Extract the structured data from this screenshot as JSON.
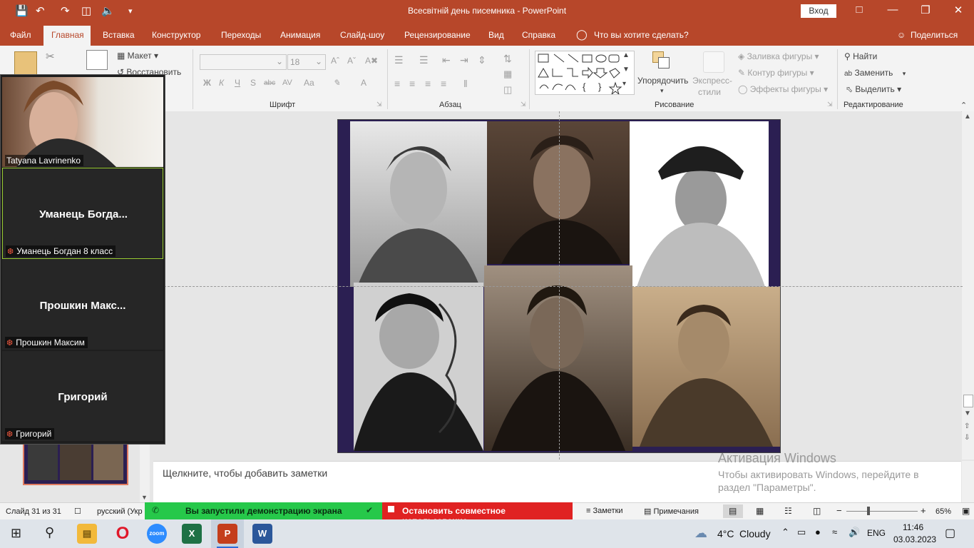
{
  "window": {
    "title": "Всесвітній день писемника - PowerPoint",
    "sign_in": "Вход"
  },
  "tabs": [
    "Файл",
    "Главная",
    "Вставка",
    "Конструктор",
    "Переходы",
    "Анимация",
    "Слайд-шоу",
    "Рецензирование",
    "Вид",
    "Справка"
  ],
  "tell_me": "Что вы хотите сделать?",
  "share": "Поделиться",
  "ribbon": {
    "layout": "Макет",
    "reset": "Восстановить",
    "font_size": "18",
    "groups": {
      "font": "Шрифт",
      "paragraph": "Абзац",
      "drawing": "Рисование",
      "editing": "Редактирование"
    },
    "arrange": "Упорядочить",
    "quick_styles": "Экспресс-\nстили",
    "quick_styles_l1": "Экспресс-",
    "quick_styles_l2": "стили",
    "shape_fill": "Заливка фигуры",
    "shape_outline": "Контур фигуры",
    "shape_effects": "Эффекты фигуры",
    "find": "Найти",
    "replace": "Заменить",
    "select": "Выделить",
    "format_buttons": [
      "Ж",
      "К",
      "Ч",
      "S",
      "abc",
      "AV",
      "Aa",
      "A"
    ]
  },
  "participants": [
    {
      "display": "",
      "label": "Tatyana Lavrinenko",
      "video": true
    },
    {
      "display": "Уманець  Богда...",
      "label": "Уманець Богдан 8 класс",
      "muted": true
    },
    {
      "display": "Прошкин  Макс...",
      "label": "Прошкин Максим",
      "muted": true
    },
    {
      "display": "Григорий",
      "label": "Григорий",
      "muted": true
    }
  ],
  "notes_placeholder": "Щелкните, чтобы добавить заметки",
  "activation": {
    "title": "Активация Windows",
    "line1": "Чтобы активировать Windows, перейдите в",
    "line2": "раздел \"Параметры\"."
  },
  "status": {
    "slide": "Слайд 31 из 31",
    "language": "русский (Укр",
    "sharing": "Вы запустили демонстрацию экрана",
    "stop_share": "Остановить совместное использование",
    "notes": "Заметки",
    "comments": "Примечания",
    "zoom": "65%"
  },
  "taskbar": {
    "weather_temp": "4°C",
    "weather_text": "Cloudy",
    "lang": "ENG",
    "time": "11:46",
    "date": "03.03.2023"
  },
  "colors": {
    "accent": "#b7472a",
    "share_green": "#26c84a",
    "stop_red": "#e02222"
  }
}
